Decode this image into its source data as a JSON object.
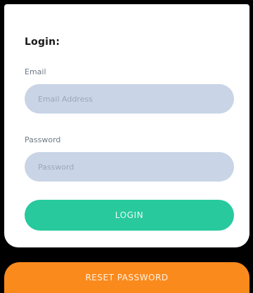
{
  "login_card": {
    "title": "Login:",
    "email": {
      "label": "Email",
      "placeholder": "Email Address",
      "value": ""
    },
    "password": {
      "label": "Password",
      "placeholder": "Password",
      "value": ""
    },
    "login_button": "LOGIN"
  },
  "reset_button": "RESET PASSWORD",
  "colors": {
    "background": "#000000",
    "card": "#ffffff",
    "input_fill": "#c9d5e6",
    "login_button": "#27c99d",
    "reset_button": "#fb8a1c"
  }
}
